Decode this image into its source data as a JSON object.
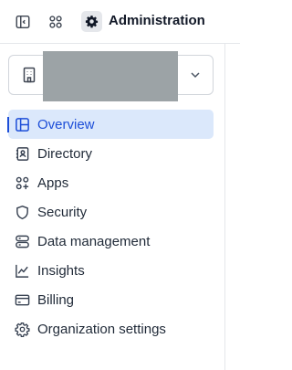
{
  "header": {
    "sidebar_toggle_icon": "sidebar-panel-icon",
    "apps_grid_icon": "grid-icon",
    "admin_icon": "gear-icon",
    "title": "Administration"
  },
  "org_selector": {
    "icon": "building-icon",
    "name_redacted": true,
    "chevron": "chevron-down-icon"
  },
  "nav": {
    "items": [
      {
        "label": "Overview",
        "icon": "layout-icon",
        "active": true
      },
      {
        "label": "Directory",
        "icon": "contacts-book-icon",
        "active": false
      },
      {
        "label": "Apps",
        "icon": "apps-plus-icon",
        "active": false
      },
      {
        "label": "Security",
        "icon": "shield-icon",
        "active": false
      },
      {
        "label": "Data management",
        "icon": "database-icon",
        "active": false
      },
      {
        "label": "Insights",
        "icon": "line-chart-icon",
        "active": false
      },
      {
        "label": "Billing",
        "icon": "credit-card-icon",
        "active": false
      },
      {
        "label": "Organization settings",
        "icon": "gear-icon",
        "active": false
      }
    ]
  },
  "colors": {
    "accent": "#1d4ed8",
    "active_bg": "#dbe8fb",
    "redaction": "#9ca3a6"
  }
}
